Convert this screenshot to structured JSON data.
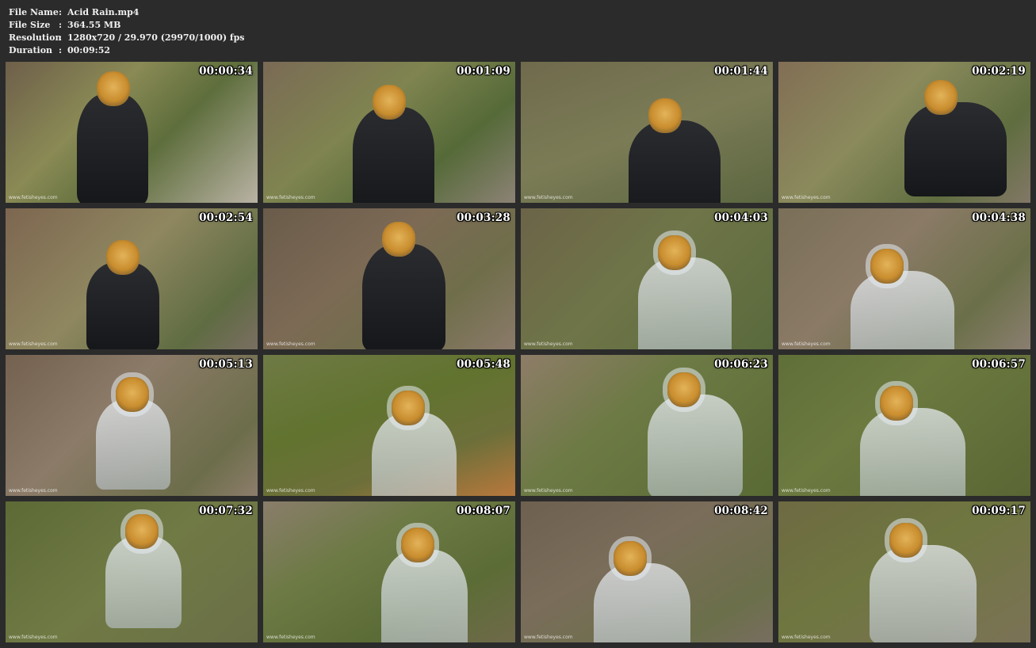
{
  "header": {
    "rows": [
      {
        "key": "File Name",
        "value": "Acid Rain.mp4"
      },
      {
        "key": "File Size",
        "value": "364.55 MB"
      },
      {
        "key": "Resolution",
        "value": "1280x720 / 29.970 (29970/1000) fps"
      },
      {
        "key": "Duration",
        "value": "00:09:52"
      }
    ],
    "separator": ":"
  },
  "thumbnails": [
    {
      "time": "00:00:34",
      "watermark": "www.fetisheyes.com"
    },
    {
      "time": "00:01:09",
      "watermark": "www.fetisheyes.com"
    },
    {
      "time": "00:01:44",
      "watermark": "www.fetisheyes.com"
    },
    {
      "time": "00:02:19",
      "watermark": "www.fetisheyes.com"
    },
    {
      "time": "00:02:54",
      "watermark": "www.fetisheyes.com"
    },
    {
      "time": "00:03:28",
      "watermark": "www.fetisheyes.com"
    },
    {
      "time": "00:04:03",
      "watermark": "www.fetisheyes.com"
    },
    {
      "time": "00:04:38",
      "watermark": "www.fetisheyes.com"
    },
    {
      "time": "00:05:13",
      "watermark": "www.fetisheyes.com"
    },
    {
      "time": "00:05:48",
      "watermark": "www.fetisheyes.com"
    },
    {
      "time": "00:06:23",
      "watermark": "www.fetisheyes.com"
    },
    {
      "time": "00:06:57",
      "watermark": "www.fetisheyes.com"
    },
    {
      "time": "00:07:32",
      "watermark": "www.fetisheyes.com"
    },
    {
      "time": "00:08:07",
      "watermark": "www.fetisheyes.com"
    },
    {
      "time": "00:08:42",
      "watermark": "www.fetisheyes.com"
    },
    {
      "time": "00:09:17",
      "watermark": "www.fetisheyes.com"
    }
  ],
  "colors": {
    "page_background": "#2b2b2b",
    "header_text": "#f0f0f0",
    "timestamp_text": "#ffffff"
  }
}
